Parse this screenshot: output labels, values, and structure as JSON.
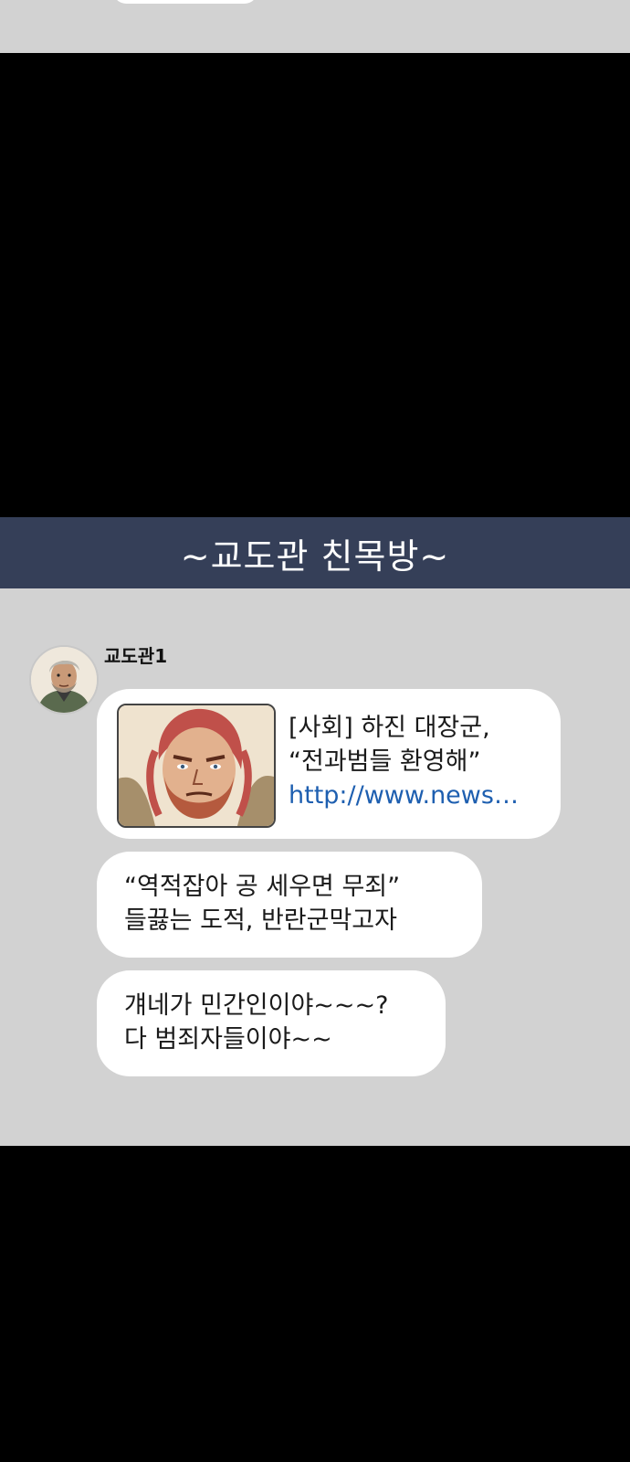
{
  "header": {
    "title": "~교도관 친목방~",
    "color": "#353f58"
  },
  "chat": {
    "background": "#d2d2d2",
    "messages": [
      {
        "sender": "교도관1",
        "type": "link",
        "link_title_line1": "[사회] 하진 대장군,",
        "link_title_line2": "“전과범들 환영해”",
        "link_url": "http://www.news…"
      },
      {
        "type": "text",
        "line1": "“역적잡아 공 세우면 무죄”",
        "line2": "들끓는 도적, 반란군막고자"
      },
      {
        "type": "text",
        "line1": "걔네가 민간인이야~~~?",
        "line2": "다 범죄자들이야~~"
      }
    ]
  },
  "icons": {
    "avatar": "person-avatar-icon",
    "thumbnail": "character-portrait-thumbnail"
  }
}
